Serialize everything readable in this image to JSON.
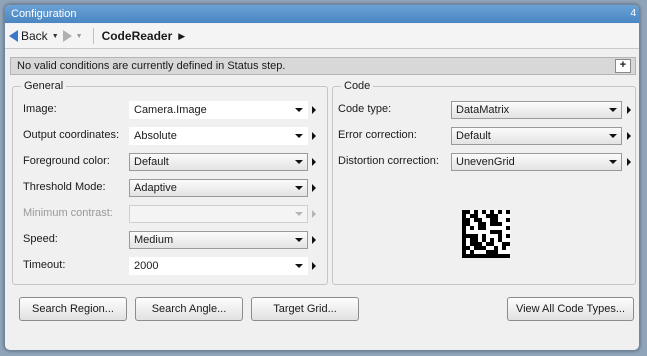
{
  "window": {
    "title": "Configuration",
    "corner_label": "4"
  },
  "nav": {
    "back_label": "Back",
    "breadcrumb": "CodeReader"
  },
  "status": {
    "message": "No valid conditions are currently defined in Status step.",
    "add_label": "+"
  },
  "general": {
    "legend": "General",
    "fields": [
      {
        "label": "Image:",
        "value": "Camera.Image",
        "enabled": true
      },
      {
        "label": "Output coordinates:",
        "value": "Absolute",
        "enabled": true
      },
      {
        "label": "Foreground color:",
        "value": "Default",
        "enabled": true
      },
      {
        "label": "Threshold Mode:",
        "value": "Adaptive",
        "enabled": true
      },
      {
        "label": "Minimum contrast:",
        "value": "",
        "enabled": false
      },
      {
        "label": "Speed:",
        "value": "Medium",
        "enabled": true
      },
      {
        "label": "Timeout:",
        "value": "2000",
        "enabled": true
      }
    ]
  },
  "code": {
    "legend": "Code",
    "fields": [
      {
        "label": "Code type:",
        "value": "DataMatrix"
      },
      {
        "label": "Error correction:",
        "value": "Default"
      },
      {
        "label": "Distortion correction:",
        "value": "UnevenGrid"
      }
    ],
    "preview_icon": "datamatrix-code-icon"
  },
  "buttons": {
    "search_region": "Search Region...",
    "search_angle": "Search Angle...",
    "target_grid": "Target Grid...",
    "view_all": "View All Code Types..."
  },
  "colors": {
    "title_bar": "#4a86c2",
    "background": "#8fa4b8"
  }
}
